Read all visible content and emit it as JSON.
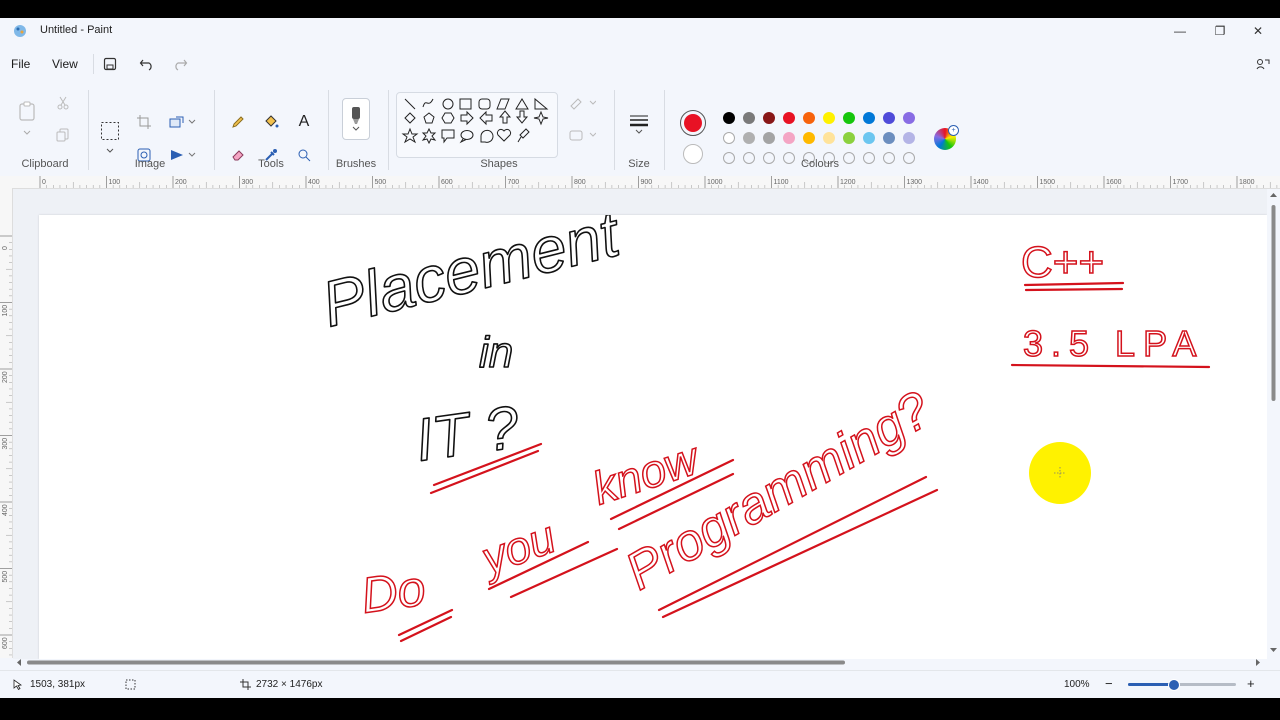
{
  "window": {
    "title": "Untitled - Paint",
    "minimize_label": "—",
    "restore_label": "❐",
    "close_label": "✕"
  },
  "menu": {
    "file": "File",
    "view": "View"
  },
  "ribbon": {
    "groups": {
      "clipboard": "Clipboard",
      "image": "Image",
      "tools": "Tools",
      "brushes": "Brushes",
      "shapes": "Shapes",
      "size": "Size",
      "colours": "Colours"
    },
    "tools_text_glyph": "A",
    "primary_color": "#e81224",
    "secondary_color": "#ffffff",
    "palette_row1": [
      "#000000",
      "#7a7a7a",
      "#881717",
      "#e81224",
      "#f7630c",
      "#fff100",
      "#16c60c",
      "#0078d7",
      "#4f4bd9",
      "#886ce4"
    ],
    "palette_row2": [
      "#ffffff",
      "#b0b0b0",
      "#a4a4a4",
      "#f4a5c4",
      "#ffb900",
      "#ffe39a",
      "#8cd13f",
      "#6cc6f0",
      "#6c8ebf",
      "#b4b4e6"
    ]
  },
  "rulers": {
    "h_labels": [
      "0",
      "100",
      "200",
      "300",
      "400",
      "500",
      "600",
      "700",
      "800",
      "900",
      "1000",
      "1100",
      "1200",
      "1300",
      "1400",
      "1500",
      "1600",
      "1700",
      "1800"
    ],
    "v_labels": [
      "0",
      "100",
      "200",
      "300",
      "400",
      "500",
      "600"
    ]
  },
  "drawing": {
    "black_line1": "Placement",
    "black_line2": "in",
    "black_line3": "IT ?",
    "red_words": [
      "Do",
      "you",
      "know",
      "Programming?"
    ],
    "right_line1": "C++",
    "right_line2": "3.5 LPA",
    "ink_black": "#111111",
    "ink_red": "#d4121c",
    "cursor_highlight": "#fff200"
  },
  "status": {
    "cursor_position": "1503, 381px",
    "canvas_size": "2732 × 1476px",
    "zoom": "100%",
    "zoom_out": "−",
    "zoom_in": "+"
  }
}
